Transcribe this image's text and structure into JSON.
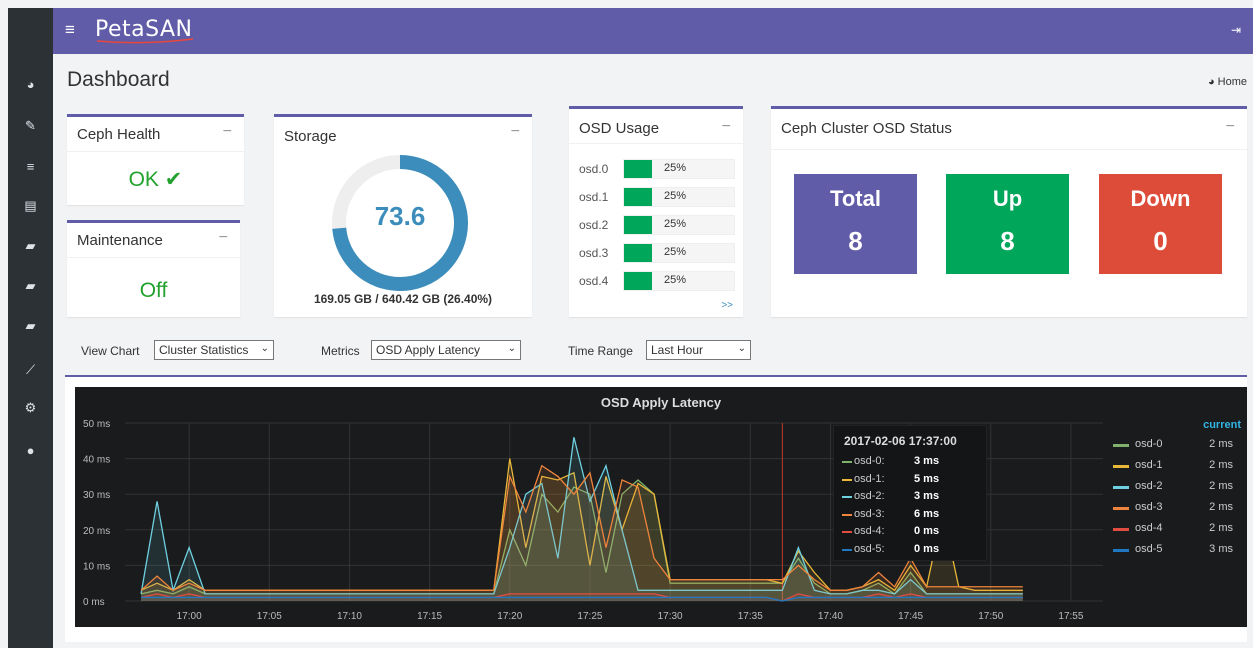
{
  "header": {
    "logo": "PetaSAN"
  },
  "page": {
    "title": "Dashboard",
    "breadcrumb": "Home"
  },
  "sidebar": {
    "items": [
      {
        "icon": "dashboard-icon"
      },
      {
        "icon": "wrench-icon"
      },
      {
        "icon": "list-icon"
      },
      {
        "icon": "server-icon"
      },
      {
        "icon": "folder-icon"
      },
      {
        "icon": "folder-icon"
      },
      {
        "icon": "folder-icon"
      },
      {
        "icon": "chart-icon"
      },
      {
        "icon": "tools-icon"
      },
      {
        "icon": "user-icon"
      }
    ]
  },
  "ceph_health": {
    "title": "Ceph Health",
    "status": "OK",
    "status_color": "#22a22c"
  },
  "maintenance": {
    "title": "Maintenance",
    "status": "Off"
  },
  "storage": {
    "title": "Storage",
    "value": "73.6",
    "fraction": 0.736,
    "capacity": "169.05 GB / 640.42 GB (26.40%)"
  },
  "osd_usage": {
    "title": "OSD Usage",
    "more": ">>",
    "items": [
      {
        "name": "osd.0",
        "pct": "25%",
        "fraction": 0.25
      },
      {
        "name": "osd.1",
        "pct": "25%",
        "fraction": 0.25
      },
      {
        "name": "osd.2",
        "pct": "25%",
        "fraction": 0.25
      },
      {
        "name": "osd.3",
        "pct": "25%",
        "fraction": 0.25
      },
      {
        "name": "osd.4",
        "pct": "25%",
        "fraction": 0.25
      }
    ]
  },
  "osd_status": {
    "title": "Ceph Cluster OSD Status",
    "total": {
      "label": "Total",
      "value": "8",
      "color": "#605ca8"
    },
    "up": {
      "label": "Up",
      "value": "8",
      "color": "#00a65a"
    },
    "down": {
      "label": "Down",
      "value": "0",
      "color": "#dd4b39"
    }
  },
  "controls": {
    "view_chart": {
      "label": "View Chart",
      "value": "Cluster Statistics"
    },
    "metrics": {
      "label": "Metrics",
      "value": "OSD Apply Latency"
    },
    "time_range": {
      "label": "Time Range",
      "value": "Last Hour"
    }
  },
  "chart_data": {
    "type": "line",
    "title": "OSD Apply Latency",
    "y_ticks": [
      "0 ms",
      "10 ms",
      "20 ms",
      "30 ms",
      "40 ms",
      "50 ms"
    ],
    "ylim": [
      0,
      50
    ],
    "x_ticks": [
      "17:00",
      "17:05",
      "17:10",
      "17:15",
      "17:20",
      "17:25",
      "17:30",
      "17:35",
      "17:40",
      "17:45",
      "17:50",
      "17:55"
    ],
    "x": [
      "16:57",
      "16:58",
      "16:59",
      "17:00",
      "17:01",
      "17:02",
      "17:03",
      "17:04",
      "17:05",
      "17:06",
      "17:07",
      "17:08",
      "17:09",
      "17:10",
      "17:11",
      "17:12",
      "17:13",
      "17:14",
      "17:15",
      "17:16",
      "17:17",
      "17:18",
      "17:19",
      "17:20",
      "17:21",
      "17:22",
      "17:23",
      "17:24",
      "17:25",
      "17:26",
      "17:27",
      "17:28",
      "17:29",
      "17:30",
      "17:31",
      "17:32",
      "17:33",
      "17:34",
      "17:35",
      "17:36",
      "17:37",
      "17:38",
      "17:39",
      "17:40",
      "17:41",
      "17:42",
      "17:43",
      "17:44",
      "17:45",
      "17:46",
      "17:47",
      "17:48",
      "17:49",
      "17:50",
      "17:51",
      "17:52"
    ],
    "grid": true,
    "series": [
      {
        "name": "osd-0",
        "color": "#7eb26d",
        "values": [
          2,
          3,
          2,
          4,
          2,
          2,
          2,
          2,
          2,
          2,
          2,
          2,
          2,
          2,
          2,
          2,
          2,
          2,
          2,
          2,
          2,
          2,
          2,
          20,
          10,
          30,
          25,
          32,
          30,
          8,
          30,
          34,
          30,
          5,
          5,
          5,
          5,
          5,
          5,
          5,
          5,
          12,
          5,
          2,
          2,
          3,
          5,
          2,
          8,
          2,
          2,
          2,
          2,
          2,
          2,
          2
        ]
      },
      {
        "name": "osd-1",
        "color": "#eab839",
        "values": [
          3,
          5,
          3,
          6,
          3,
          3,
          3,
          3,
          3,
          3,
          3,
          3,
          3,
          3,
          3,
          3,
          3,
          3,
          3,
          3,
          3,
          3,
          3,
          40,
          15,
          35,
          34,
          36,
          10,
          35,
          20,
          33,
          30,
          6,
          6,
          6,
          6,
          6,
          6,
          6,
          5,
          14,
          8,
          3,
          3,
          4,
          6,
          3,
          10,
          4,
          25,
          4,
          3,
          3,
          3,
          3
        ]
      },
      {
        "name": "osd-2",
        "color": "#6ed0e0",
        "values": [
          2,
          28,
          3,
          15,
          2,
          2,
          2,
          2,
          2,
          2,
          2,
          2,
          2,
          2,
          2,
          2,
          2,
          2,
          2,
          2,
          2,
          2,
          2,
          15,
          30,
          33,
          12,
          46,
          28,
          38,
          20,
          3,
          3,
          3,
          3,
          3,
          3,
          3,
          3,
          3,
          3,
          15,
          3,
          2,
          2,
          3,
          3,
          2,
          6,
          2,
          2,
          2,
          2,
          2,
          2,
          2
        ]
      },
      {
        "name": "osd-3",
        "color": "#ef843c",
        "values": [
          3,
          7,
          3,
          5,
          3,
          3,
          3,
          3,
          3,
          3,
          3,
          3,
          3,
          3,
          3,
          3,
          3,
          3,
          3,
          3,
          3,
          3,
          3,
          35,
          25,
          38,
          35,
          30,
          36,
          15,
          34,
          32,
          12,
          6,
          6,
          6,
          6,
          6,
          6,
          6,
          6,
          10,
          6,
          3,
          3,
          4,
          8,
          4,
          12,
          4,
          4,
          4,
          4,
          4,
          4,
          4
        ]
      },
      {
        "name": "osd-4",
        "color": "#e24d42",
        "values": [
          1,
          2,
          1,
          2,
          1,
          1,
          1,
          1,
          1,
          1,
          1,
          1,
          1,
          1,
          1,
          1,
          1,
          1,
          1,
          1,
          1,
          1,
          1,
          2,
          2,
          2,
          2,
          2,
          2,
          2,
          2,
          2,
          2,
          1,
          1,
          1,
          1,
          1,
          1,
          1,
          0,
          2,
          1,
          1,
          1,
          1,
          2,
          1,
          2,
          1,
          1,
          1,
          1,
          1,
          1,
          1
        ]
      },
      {
        "name": "osd-5",
        "color": "#1f78c1",
        "values": [
          1,
          1,
          1,
          1,
          1,
          1,
          1,
          1,
          1,
          1,
          1,
          1,
          1,
          1,
          1,
          1,
          1,
          1,
          1,
          1,
          1,
          1,
          1,
          1,
          1,
          1,
          1,
          1,
          1,
          1,
          1,
          1,
          1,
          1,
          1,
          1,
          1,
          1,
          1,
          1,
          0,
          1,
          1,
          1,
          1,
          1,
          1,
          1,
          1,
          1,
          1,
          1,
          1,
          1,
          1,
          1
        ]
      }
    ],
    "legend": {
      "header": "current",
      "values": [
        "2 ms",
        "2 ms",
        "2 ms",
        "2 ms",
        "2 ms",
        "3 ms"
      ]
    },
    "cursor_x": "17:37",
    "tooltip": {
      "time": "2017-02-06 17:37:00",
      "rows": [
        {
          "name": "osd-0:",
          "value": "3 ms"
        },
        {
          "name": "osd-1:",
          "value": "5 ms"
        },
        {
          "name": "osd-2:",
          "value": "3 ms"
        },
        {
          "name": "osd-3:",
          "value": "6 ms"
        },
        {
          "name": "osd-4:",
          "value": "0 ms"
        },
        {
          "name": "osd-5:",
          "value": "0 ms"
        }
      ]
    }
  }
}
